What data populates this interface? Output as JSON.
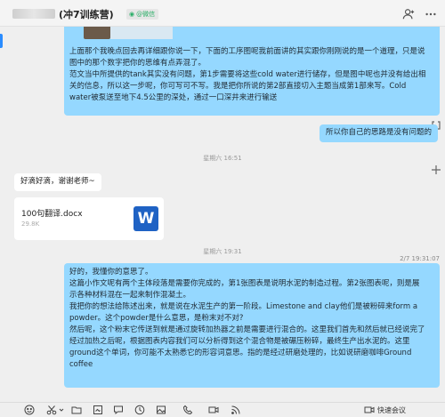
{
  "header": {
    "title": "(冲7训练营)",
    "badge": "@微信"
  },
  "messages": {
    "m1": {
      "lines": [
        "上面那个我晚点回去再详细跟你说一下，下面的工序图呢我前面讲的其实跟你刚刚说的是一个道理，只是说",
        "图中的那个数字把你的思维有点弄混了。",
        "范文当中所提供的tank其实没有问题，第1步需要将这些cold water进行储存，但是图中呢也并没有给出相",
        "关的信息，所以这一步呢，你可写可不写。我是把你所说的第2部直接切入主题当成第1部来写。Cold",
        "water被泵送至地下4.5公里的深处，通过一口深井来进行输送"
      ]
    },
    "m2": "所以你自己的思路是没有问题的",
    "time1": "星期六 16:51",
    "m3": "好滴好滴，谢谢老师~",
    "file": {
      "name": "100句翻译.docx",
      "size": "29.8K",
      "icon": "W"
    },
    "time2": "星期六 19:31",
    "time_right": "2/7 19:31:07",
    "m4": {
      "lines": [
        "好的，我懂你的意思了。",
        "这篇小作文呢有两个主体段落是需要你完成的，第1张图表是说明水泥的制造过程。第2张图表呢，则是展",
        "示各种材料混在一起来制作混凝土。",
        "我把你的想法给陈述出来，就是说在水泥生产的第一阶段。Limestone and clay他们是被粉碎来form a",
        "powder。这个powder是什么意思，是粉末对不对?",
        "然后呢，这个粉末它传送到就是通过旋转加热器之前是需要进行混合的。这里我们首先和然后就已经说完了",
        "经过加热之后呢，根据图表内容我们可以分析得到这个混合物是被碾压粉碎，最终生产出水泥的。这里",
        "ground这个单词，你可能不太熟悉它的形容词意思。指的是经过研磨处理的，比如说研磨咖啡Ground",
        "coffee"
      ]
    }
  },
  "toolbar": {
    "meet_label": "快速会议",
    "icons": [
      "smile-icon",
      "scissors-icon",
      "folder-icon",
      "screenshot-icon",
      "chat-bubble-icon",
      "clock-icon",
      "image-icon",
      "phone-icon",
      "video-icon",
      "rss-icon"
    ]
  },
  "colors": {
    "outgoing_bubble": "#95d8ff",
    "incoming_bubble": "#ffffff",
    "background": "#efefef",
    "word_blue": "#1f62c4",
    "wechat_green": "#2aae67"
  }
}
